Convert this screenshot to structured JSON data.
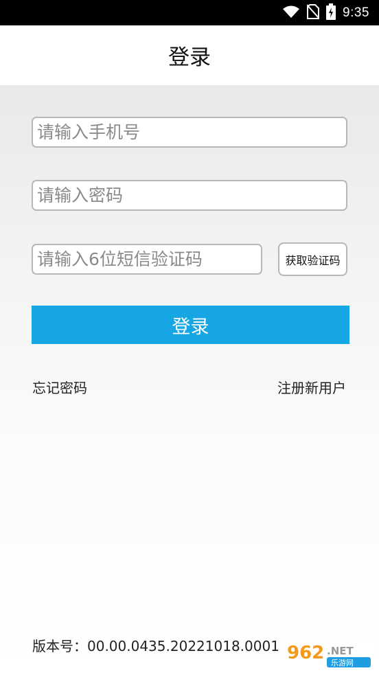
{
  "status_bar": {
    "time": "9:35",
    "icons": [
      "wifi-icon",
      "no-sim-icon",
      "battery-charging-icon"
    ]
  },
  "header": {
    "title": "登录"
  },
  "form": {
    "phone_placeholder": "请输入手机号",
    "password_placeholder": "请输入密码",
    "code_placeholder": "请输入6位短信验证码",
    "get_code_label": "获取验证码",
    "login_label": "登录"
  },
  "links": {
    "forgot_password": "忘记密码",
    "register": "注册新用户"
  },
  "footer": {
    "version": "版本号：00.00.0435.20221018.0001"
  },
  "watermark": {
    "brand": "962.NET",
    "sub": "乐游网"
  },
  "colors": {
    "accent": "#16a6e3",
    "status_bar": "#000000",
    "field_border": "#b7b7b7"
  }
}
